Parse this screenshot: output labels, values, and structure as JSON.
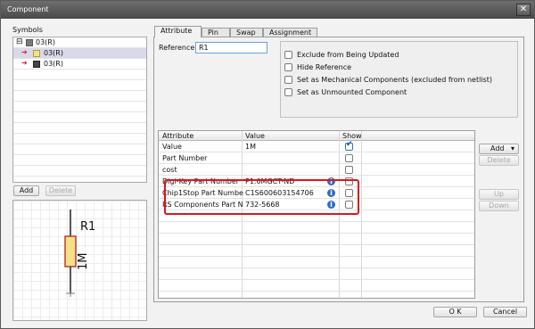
{
  "window": {
    "title": "Component"
  },
  "symbols": {
    "label": "Symbols",
    "items": [
      {
        "expander": "⊟",
        "name": "03(R)"
      },
      {
        "name": "03(R)"
      },
      {
        "name": "03(R)"
      }
    ],
    "add_label": "Add",
    "delete_label": "Delete"
  },
  "preview": {
    "ref": "R1",
    "value": "1M"
  },
  "tabs": [
    {
      "label": "Attribute"
    },
    {
      "label": "Pin"
    },
    {
      "label": "Swap"
    },
    {
      "label": "Assignment"
    }
  ],
  "reference": {
    "label": "Reference",
    "value": "R1"
  },
  "options": [
    {
      "label": "Exclude from Being Updated",
      "checked": false
    },
    {
      "label": "Hide Reference",
      "checked": false
    },
    {
      "label": "Set as Mechanical Components (excluded from netlist)",
      "checked": false
    },
    {
      "label": "Set as Unmounted Component",
      "checked": false
    }
  ],
  "grid": {
    "columns": [
      "Attribute",
      "Value",
      "Show"
    ],
    "rows": [
      {
        "attribute": "Value",
        "value": "1M",
        "show": true
      },
      {
        "attribute": "Part Number",
        "value": "",
        "show": false
      },
      {
        "attribute": "cost",
        "value": "",
        "show": false
      },
      {
        "attribute": "Digi-Key Part Number",
        "value": "P1.0MGCT-ND",
        "show": false,
        "info": true
      },
      {
        "attribute": "Chip1Stop Part Numbe",
        "value": "C1S600603154706",
        "show": false,
        "info": true
      },
      {
        "attribute": "RS Components Part N",
        "value": "732-5668",
        "show": false,
        "info": true
      }
    ]
  },
  "side_buttons": {
    "add": "Add",
    "delete": "Delete",
    "up": "Up",
    "down": "Down"
  },
  "footer": {
    "ok": "O K",
    "cancel": "Cancel"
  },
  "colors": {
    "highlight": "#d8181e",
    "info": "#2c6cc4",
    "arrow": "#d8181e"
  }
}
